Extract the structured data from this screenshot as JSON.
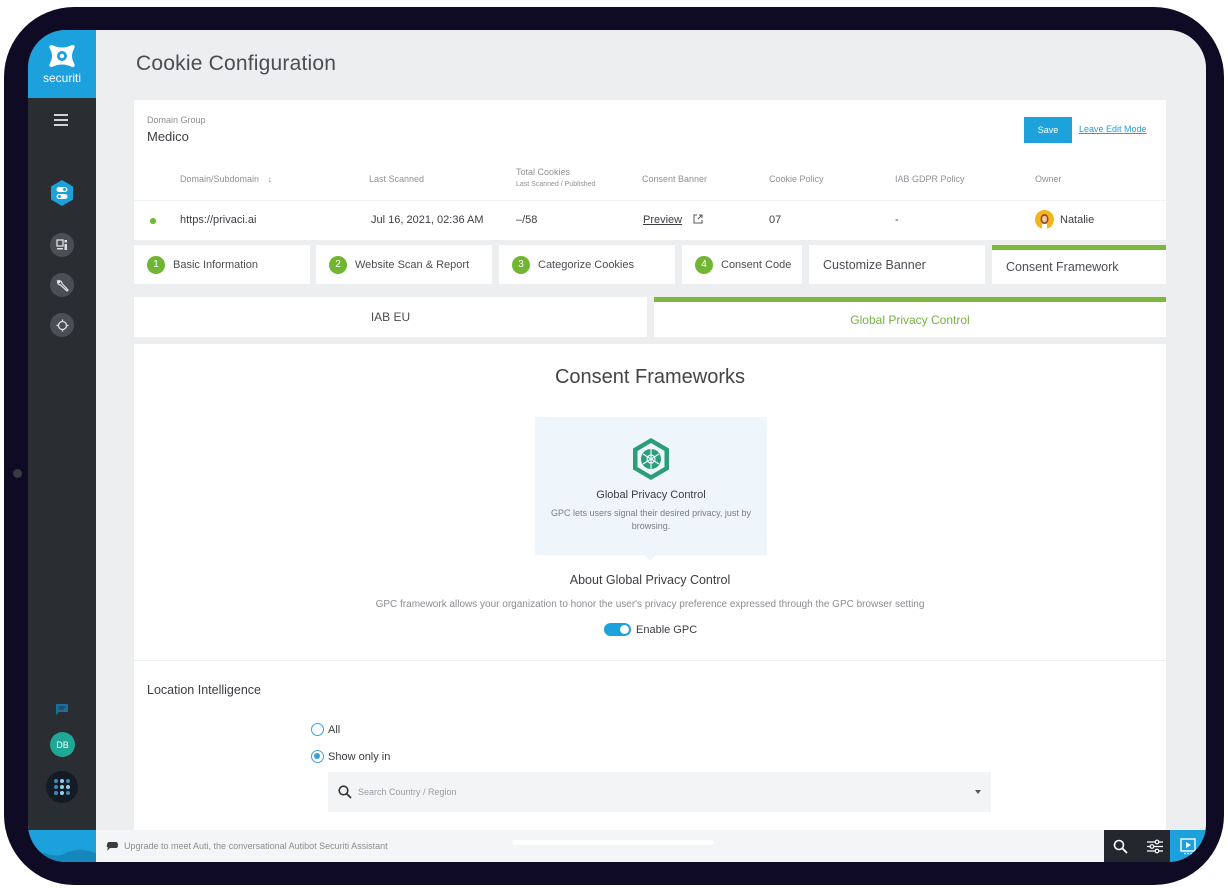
{
  "brand": {
    "name": "securiti",
    "accent": "#1da1dc",
    "green": "#71b632"
  },
  "page": {
    "title": "Cookie Configuration"
  },
  "domain_group": {
    "label": "Domain Group",
    "value": "Medico"
  },
  "actions": {
    "save": "Save",
    "leave_edit": "Leave Edit Mode"
  },
  "table": {
    "columns": {
      "domain": "Domain/Subdomain",
      "last_scanned": "Last Scanned",
      "total_cookies": "Total Cookies",
      "total_cookies_sub": "Last Scanned / Published",
      "consent_banner": "Consent Banner",
      "cookie_policy": "Cookie Policy",
      "iab_gdpr": "IAB GDPR Policy",
      "owner": "Owner"
    },
    "sort_icon": "↓",
    "row": {
      "domain": "https://privaci.ai",
      "last_scanned": "Jul 16, 2021, 02:36 AM",
      "total_cookies": "–/58",
      "consent_banner": "Preview",
      "cookie_policy": "07",
      "iab_gdpr": "-",
      "owner": "Natalie"
    }
  },
  "steps": [
    {
      "num": "1",
      "label": "Basic Information"
    },
    {
      "num": "2",
      "label": "Website Scan & Report"
    },
    {
      "num": "3",
      "label": "Categorize Cookies"
    },
    {
      "num": "4",
      "label": "Consent Code"
    },
    {
      "num": "",
      "label": "Customize Banner"
    },
    {
      "num": "",
      "label": "Consent Framework",
      "active": true
    }
  ],
  "subtabs": [
    {
      "label": "IAB EU"
    },
    {
      "label": "Global Privacy Control",
      "active": true
    }
  ],
  "content": {
    "title": "Consent Frameworks",
    "framework_card": {
      "name": "Global Privacy Control",
      "description": "GPC lets users signal their desired privacy, just by browsing."
    },
    "about_title": "About Global Privacy Control",
    "about_desc": "GPC framework allows your organization to honor the user's privacy preference expressed through the GPC browser setting",
    "toggle": {
      "label": "Enable GPC",
      "enabled": true
    },
    "location": {
      "title": "Location Intelligence",
      "options": [
        {
          "label": "All",
          "selected": false
        },
        {
          "label": "Show only in",
          "selected": true
        }
      ],
      "search_placeholder": "Search Country / Region"
    }
  },
  "sidebar": {
    "avatar_initials": "DB"
  },
  "bottom_bar": {
    "message": "Upgrade to meet Auti, the conversational Autibot Securiti Assistant"
  }
}
